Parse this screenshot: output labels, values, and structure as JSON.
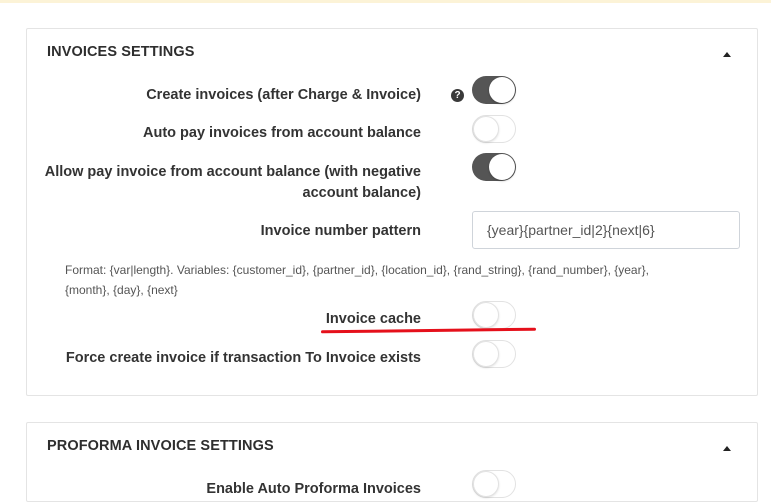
{
  "invoices": {
    "title": "INVOICES SETTINGS",
    "settings": {
      "create_invoices": {
        "label": "Create invoices (after Charge & Invoice)",
        "help": "?",
        "enabled": true
      },
      "auto_pay": {
        "label": "Auto pay invoices from account balance",
        "enabled": false
      },
      "allow_pay_negative": {
        "label_line1": "Allow pay invoice from account balance (with negative",
        "label_line2": "account balance)",
        "enabled": true
      },
      "number_pattern": {
        "label": "Invoice number pattern",
        "value": "{year}{partner_id|2}{next|6}"
      },
      "format_hint_line1": "Format: {var|length}. Variables: {customer_id}, {partner_id}, {location_id}, {rand_string}, {rand_number}, {year},",
      "format_hint_line2": "{month}, {day}, {next}",
      "invoice_cache": {
        "label": "Invoice cache",
        "enabled": false
      },
      "force_create": {
        "label": "Force create invoice if transaction To Invoice exists",
        "enabled": false
      }
    }
  },
  "proforma": {
    "title": "PROFORMA INVOICE SETTINGS",
    "settings": {
      "enable_auto_proforma": {
        "label": "Enable Auto Proforma Invoices",
        "enabled": false
      }
    }
  },
  "colors": {
    "toggle_on": "#555555",
    "annotation_underline": "#e5101b",
    "top_banner": "#fcf3d7"
  }
}
